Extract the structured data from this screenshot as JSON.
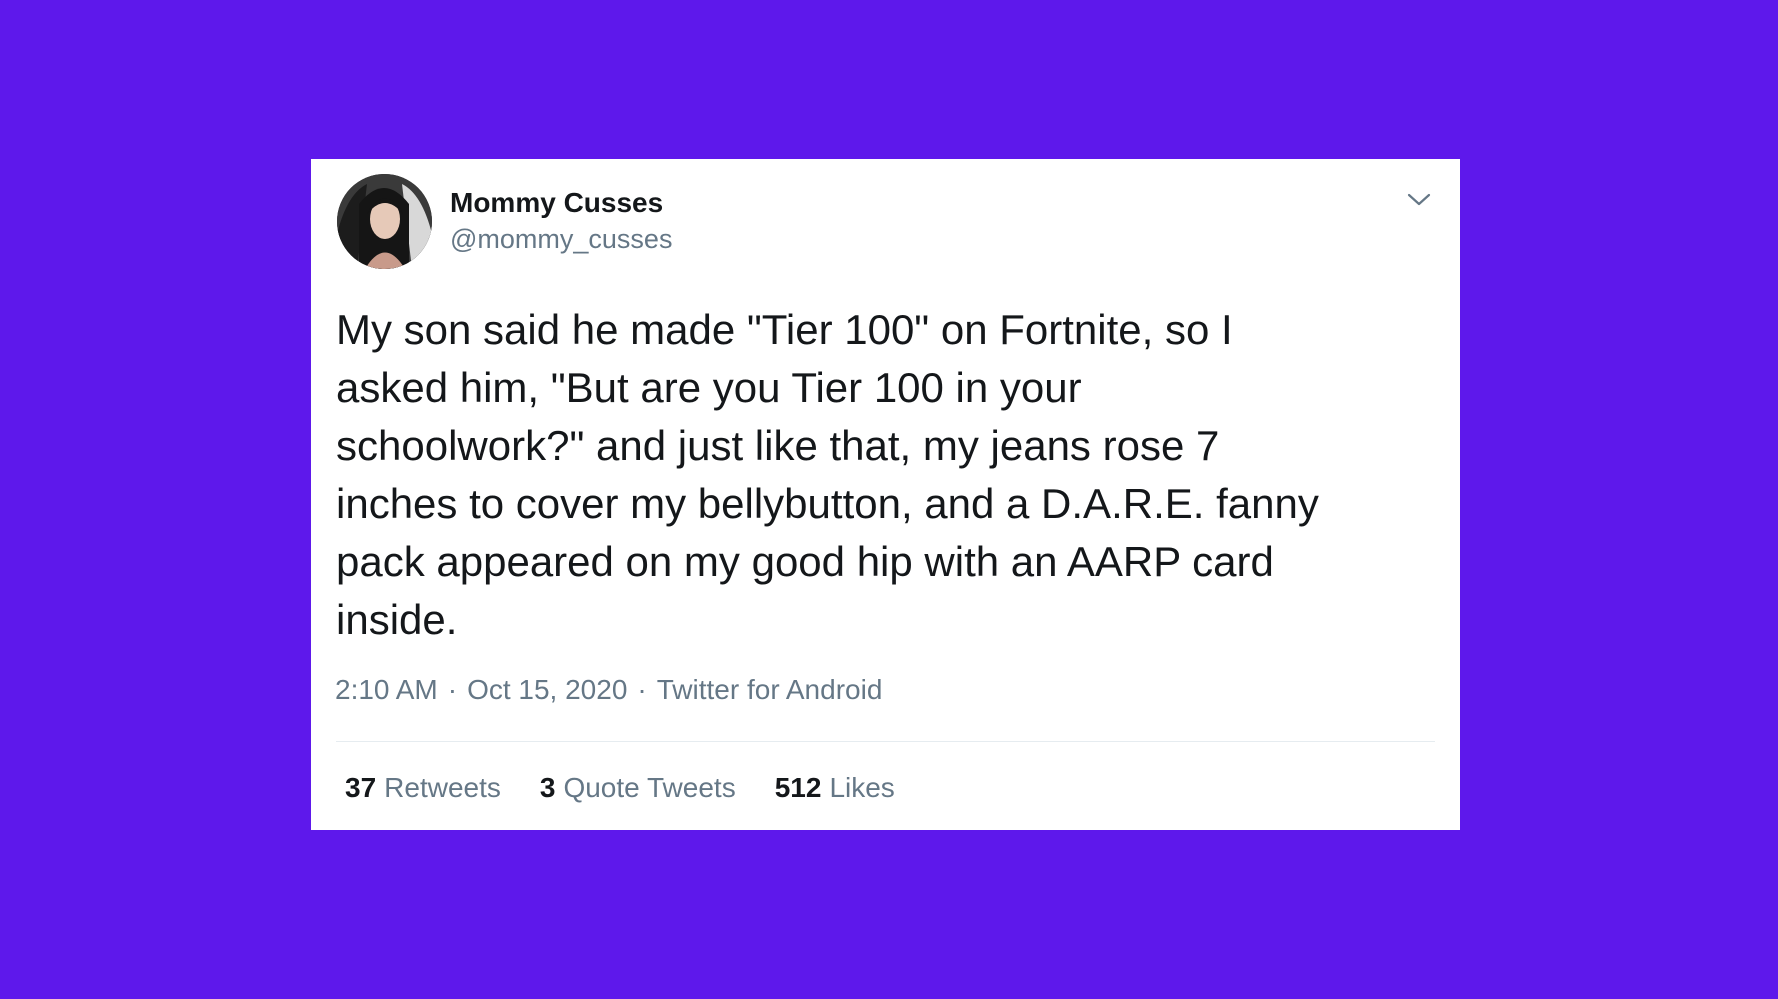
{
  "colors": {
    "background": "#5e18eb",
    "card": "#ffffff",
    "primary_text": "#14171a",
    "secondary_text": "#657786",
    "divider": "#e6ecf0"
  },
  "tweet": {
    "author_name": "Mommy Cusses",
    "author_handle": "@mommy_cusses",
    "text": "My son said he made \"Tier 100\" on Fortnite, so I\nasked him, \"But are you Tier 100 in your\nschoolwork?\" and just like that, my jeans rose 7\ninches to cover my bellybutton, and a D.A.R.E. fanny\npack appeared on my good hip with an AARP card\ninside.",
    "time": "2:10 AM",
    "date": "Oct 15, 2020",
    "source": "Twitter for Android",
    "separator": "·",
    "icons": {
      "avatar": "avatar-photo",
      "menu": "chevron-down-icon"
    },
    "stats": {
      "retweets": {
        "count": "37",
        "label": "Retweets"
      },
      "quote_tweets": {
        "count": "3",
        "label": "Quote Tweets"
      },
      "likes": {
        "count": "512",
        "label": "Likes"
      }
    }
  }
}
